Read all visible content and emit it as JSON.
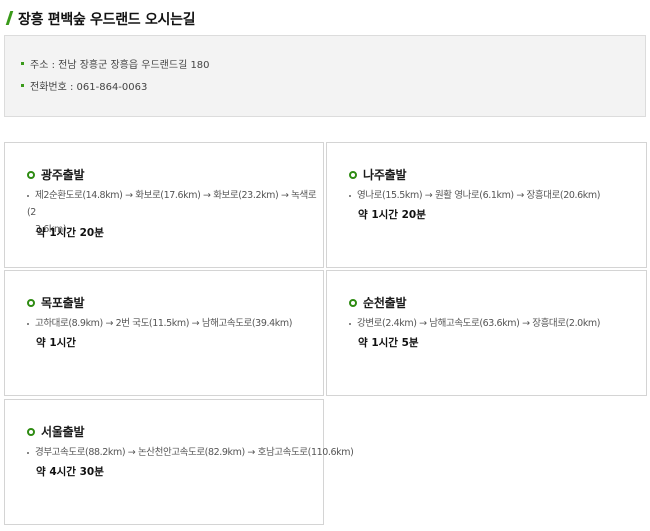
{
  "page": {
    "title": "장흥 편백숲 우드랜드 오시는길"
  },
  "info": {
    "address": "주소 : 전남 장흥군 장흥읍 우드랜드길 180",
    "phone": "전화번호 : 061-864-0063"
  },
  "routes": [
    {
      "title": "광주출발",
      "route_line1": "제2순환도로(14.8km) → 화보로(17.6km) → 화보로(23.2km) → 녹색로(2",
      "route_line2": "3.6km)",
      "time": "약 1시간 20분"
    },
    {
      "title": "나주출발",
      "route_line1": "영나로(15.5km) → 원활 영나로(6.1km) → 장흥대로(20.6km)",
      "time": "약 1시간 20분"
    },
    {
      "title": "목포출발",
      "route_line1": "고하대로(8.9km) → 2번 국도(11.5km) → 남해고속도로(39.4km)",
      "time": "약 1시간"
    },
    {
      "title": "순천출발",
      "route_line1": "강변로(2.4km) → 남해고속도로(63.6km) → 장흥대로(2.0km)",
      "time": "약 1시간 5분"
    },
    {
      "title": "서울출발",
      "route_line1": "경부고속도로(88.2km) → 논산천안고속도로(82.9km) → 호남고속도로(110.6km)",
      "time": "약 4시간 30분"
    }
  ]
}
